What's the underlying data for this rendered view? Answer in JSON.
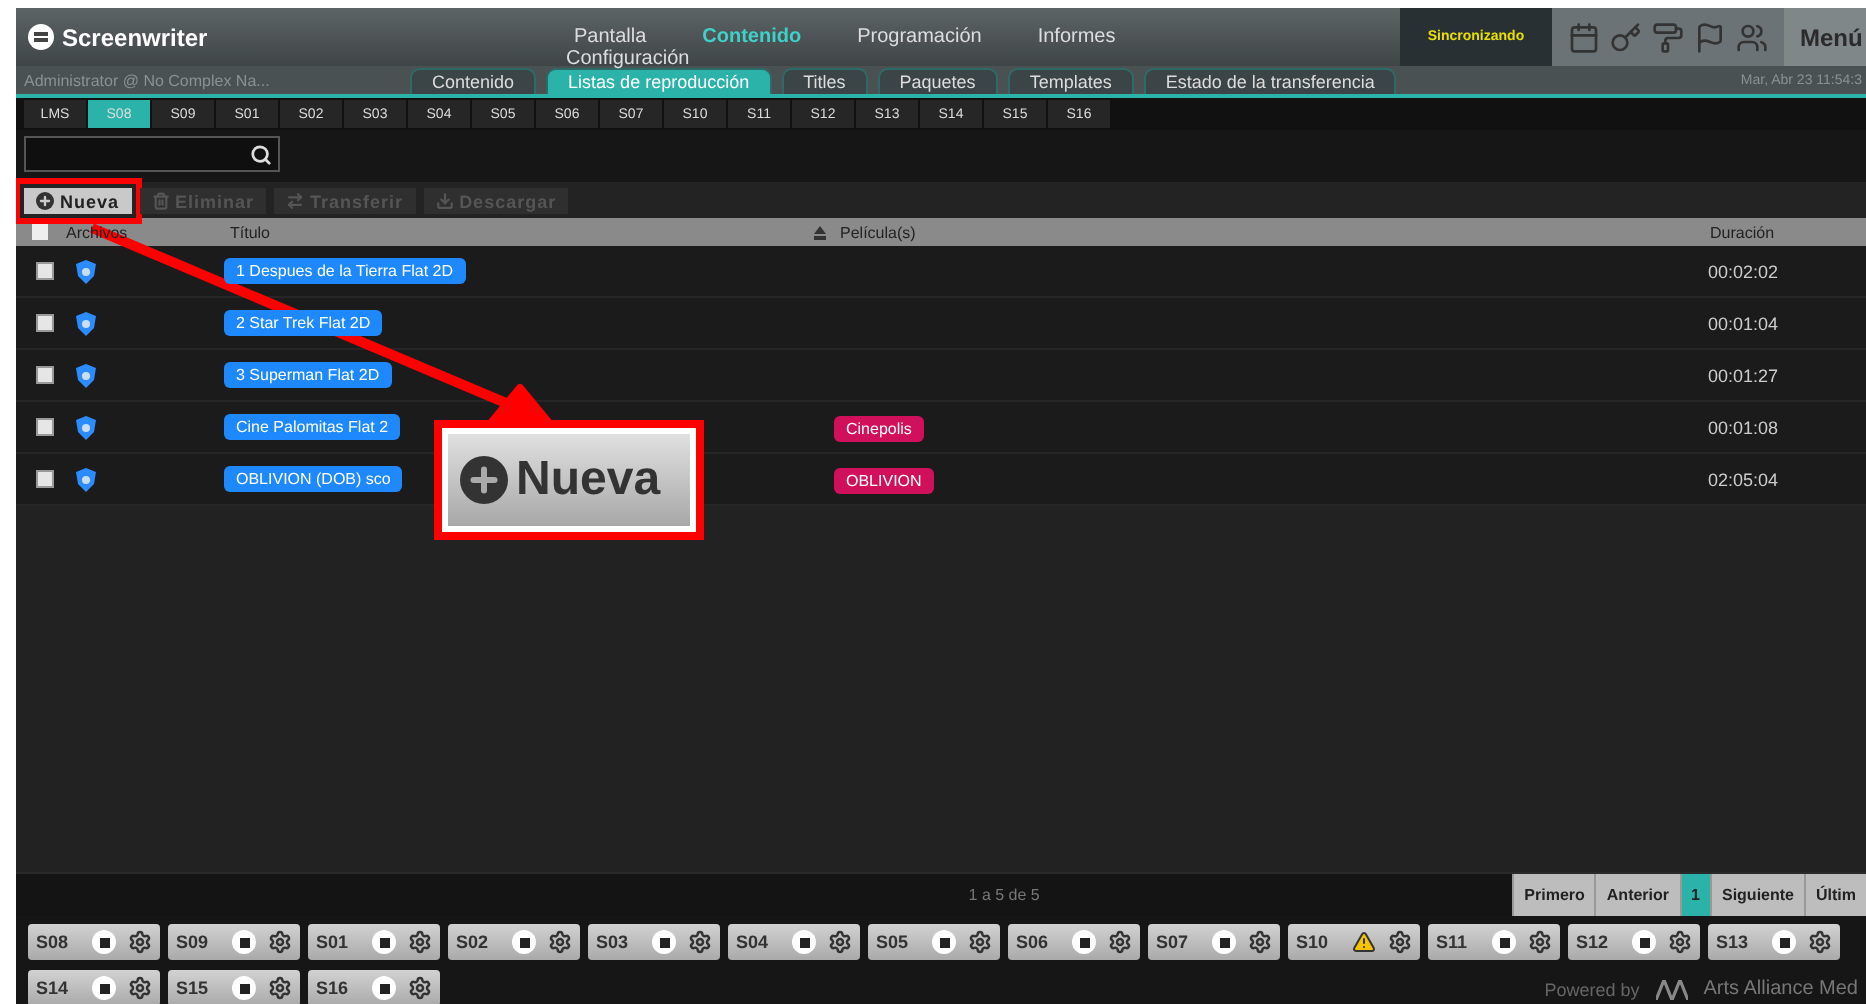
{
  "app": {
    "logo": "Screenwriter",
    "user": "Administrator @ No Complex Na...",
    "datetime": "Mar, Abr 23 11:54:3",
    "sync_status": "Sincronizando",
    "menu": "Menú"
  },
  "nav": [
    {
      "label": "Pantalla",
      "selected": false
    },
    {
      "label": "Contenido",
      "selected": true
    },
    {
      "label": "Programación",
      "selected": false
    },
    {
      "label": "Informes",
      "selected": false
    }
  ],
  "nav_overlay": "Configuración",
  "subtabs": [
    {
      "label": "Contenido",
      "selected": false
    },
    {
      "label": "Listas de reproducción",
      "selected": true
    },
    {
      "label": "Titles",
      "selected": false
    },
    {
      "label": "Paquetes",
      "selected": false
    },
    {
      "label": "Templates",
      "selected": false
    },
    {
      "label": "Estado de la transferencia",
      "selected": false
    }
  ],
  "screens": [
    {
      "label": "LMS",
      "selected": false
    },
    {
      "label": "S08",
      "selected": true
    },
    {
      "label": "S09",
      "selected": false
    },
    {
      "label": "S01",
      "selected": false
    },
    {
      "label": "S02",
      "selected": false
    },
    {
      "label": "S03",
      "selected": false
    },
    {
      "label": "S04",
      "selected": false
    },
    {
      "label": "S05",
      "selected": false
    },
    {
      "label": "S06",
      "selected": false
    },
    {
      "label": "S07",
      "selected": false
    },
    {
      "label": "S10",
      "selected": false
    },
    {
      "label": "S11",
      "selected": false
    },
    {
      "label": "S12",
      "selected": false
    },
    {
      "label": "S13",
      "selected": false
    },
    {
      "label": "S14",
      "selected": false
    },
    {
      "label": "S15",
      "selected": false
    },
    {
      "label": "S16",
      "selected": false
    }
  ],
  "toolbar": [
    {
      "label": "Nueva",
      "disabled": false
    },
    {
      "label": "Eliminar",
      "disabled": true
    },
    {
      "label": "Transferir",
      "disabled": true
    },
    {
      "label": "Descargar",
      "disabled": true
    }
  ],
  "table": {
    "all_checked": false,
    "columns": [
      "Archivos",
      "Título",
      "Película(s)",
      "Duración"
    ],
    "rows": [
      {
        "checked": false,
        "title": "1 Despues de la Tierra Flat 2D",
        "film": null,
        "duration": "00:02:02"
      },
      {
        "checked": false,
        "title": "2 Star Trek Flat 2D",
        "film": null,
        "duration": "00:01:04"
      },
      {
        "checked": false,
        "title": "3 Superman Flat 2D",
        "film": null,
        "duration": "00:01:27"
      },
      {
        "checked": false,
        "title": "Cine Palomitas Flat 2",
        "film": "Cinepolis",
        "duration": "00:01:08"
      },
      {
        "checked": false,
        "title": "OBLIVION (DOB) sco",
        "film": "OBLIVION",
        "duration": "02:05:04"
      }
    ]
  },
  "pagination": {
    "summary": "1 a 5 de 5",
    "buttons": [
      {
        "label": "Primero",
        "selected": false
      },
      {
        "label": "Anterior",
        "selected": false
      },
      {
        "label": "1",
        "selected": true
      },
      {
        "label": "Siguiente",
        "selected": false
      },
      {
        "label": "Últim",
        "selected": false
      }
    ]
  },
  "screen_status": [
    {
      "label": "S08",
      "kind": "ok"
    },
    {
      "label": "S09",
      "kind": "ok"
    },
    {
      "label": "S01",
      "kind": "ok"
    },
    {
      "label": "S02",
      "kind": "ok"
    },
    {
      "label": "S03",
      "kind": "ok"
    },
    {
      "label": "S04",
      "kind": "ok"
    },
    {
      "label": "S05",
      "kind": "ok"
    },
    {
      "label": "S06",
      "kind": "ok"
    },
    {
      "label": "S07",
      "kind": "ok"
    },
    {
      "label": "S10",
      "kind": "warning"
    },
    {
      "label": "S11",
      "kind": "ok"
    },
    {
      "label": "S12",
      "kind": "ok"
    },
    {
      "label": "S13",
      "kind": "ok"
    },
    {
      "label": "S14",
      "kind": "ok"
    },
    {
      "label": "S15",
      "kind": "ok"
    },
    {
      "label": "S16",
      "kind": "ok"
    }
  ],
  "footer": {
    "powered_by": "Powered by",
    "brand": "Arts Alliance Med"
  },
  "callout": {
    "label": "Nueva"
  }
}
